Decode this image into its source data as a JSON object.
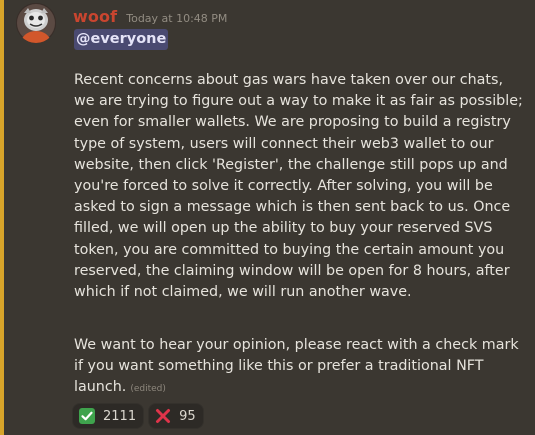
{
  "message": {
    "author": "woof",
    "timestamp": "Today at 10:48 PM",
    "mention": "@everyone",
    "paragraph_1": "Recent concerns about gas wars have taken over our chats,\nwe are trying to figure out a way to make it as fair as possible;\neven for smaller wallets. We are proposing to build a registry\ntype of system, users will connect their web3 wallet to our\nwebsite, then click 'Register', the challenge still pops up and\nyou're forced to solve it correctly. After solving, you will be\nasked to sign a message which is then sent back to us. Once\nfilled, we will open up the ability to buy your reserved SVS\ntoken, you are committed to buying the certain amount you\nreserved, the claiming window will be open for 8 hours, after\nwhich if not claimed, we will run another wave.",
    "paragraph_2": "We want to hear your opinion, please react with a check mark\nif you want something like this or prefer a traditional NFT\nlaunch.",
    "edited_label": "(edited)"
  },
  "reactions": [
    {
      "icon": "check-mark-icon",
      "count": "2111",
      "color": "#3fa34d"
    },
    {
      "icon": "cross-mark-icon",
      "count": "95",
      "color": "#e0344a"
    }
  ],
  "colors": {
    "background": "#3b3731",
    "mention_bar": "#d7a42a",
    "username": "#c9452f",
    "mention_bg": "#4a4a71"
  }
}
